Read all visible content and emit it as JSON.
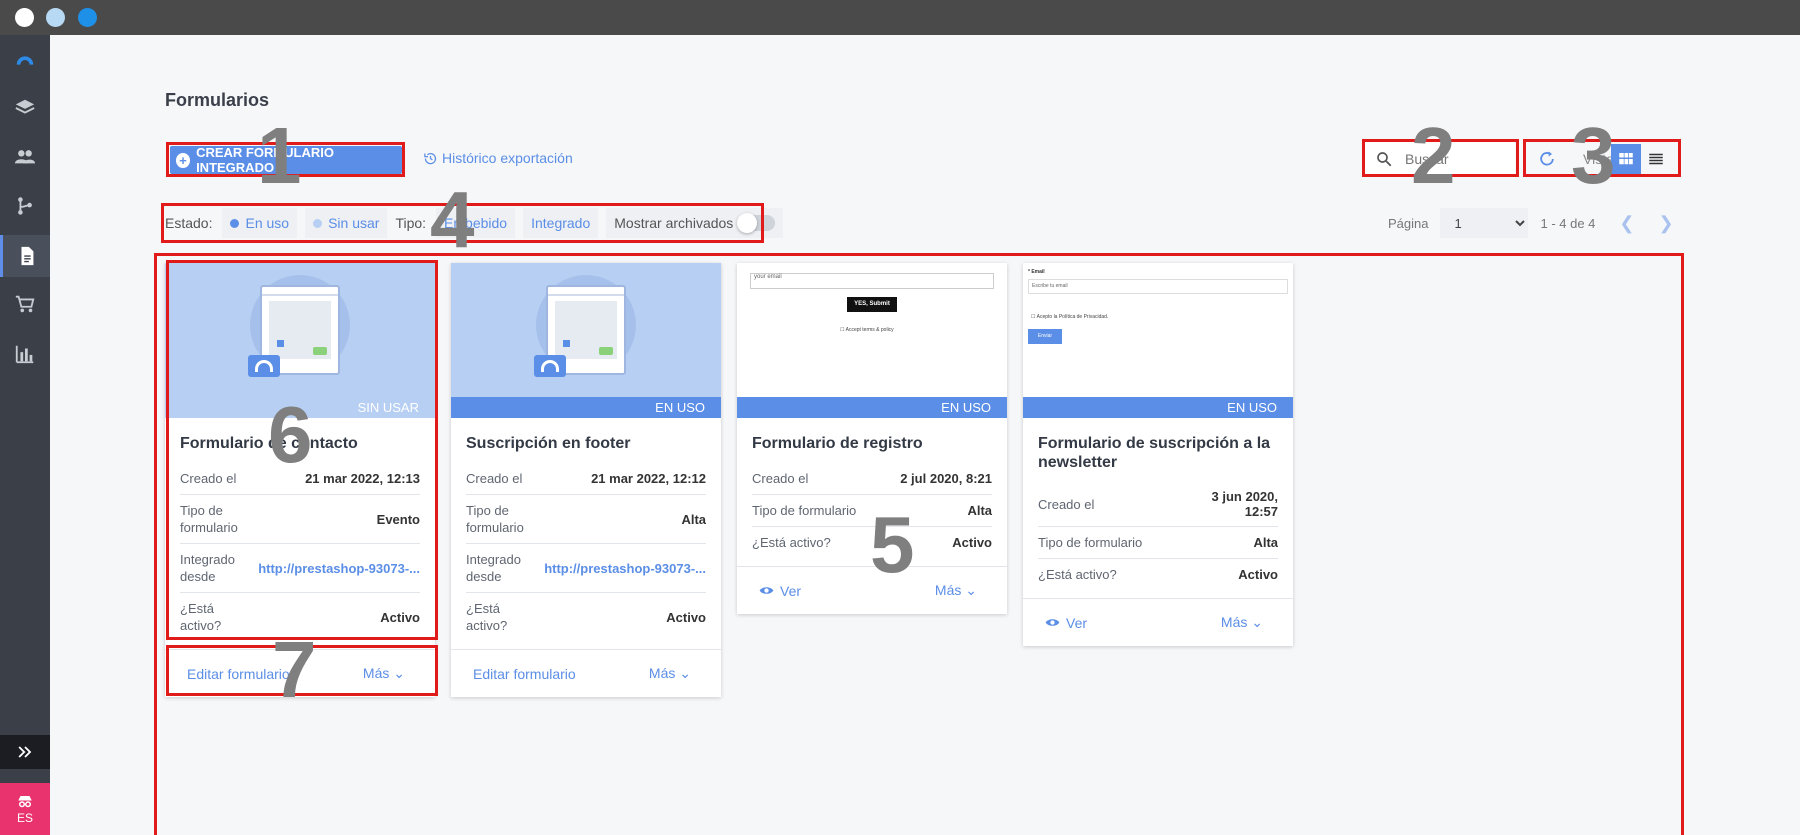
{
  "window": {
    "dots": [
      "close",
      "minimize",
      "zoom"
    ]
  },
  "sidebar": {
    "items": [
      "logo-icon",
      "layers-icon",
      "users-icon",
      "branch-icon",
      "document-icon",
      "cart-icon",
      "bar-chart-icon"
    ],
    "active": "document-icon",
    "expand_icon": "double-chevron-right-icon",
    "lang": "ES",
    "lang_icon": "incognito-icon"
  },
  "page": {
    "title": "Formularios"
  },
  "toolbar": {
    "create_label": "CREAR FORMULARIO INTEGRADO",
    "history_label": "Histórico exportación",
    "search_placeholder": "Buscar",
    "view_label": "Vista"
  },
  "filters": {
    "estado_label": "Estado:",
    "en_uso": "En uso",
    "sin_usar": "Sin usar",
    "tipo_label": "Tipo:",
    "embebido": "Embebido",
    "integrado": "Integrado",
    "archivados": "Mostrar archivados"
  },
  "pager": {
    "label": "Página",
    "page": "1",
    "count": "1 - 4 de 4"
  },
  "cards": [
    {
      "status": "SIN USAR",
      "title": "Formulario de contacto",
      "rows": [
        {
          "k": "Creado el",
          "v": "21 mar 2022, 12:13"
        },
        {
          "k": "Tipo de formulario",
          "v": "Evento"
        },
        {
          "k": "Integrado desde",
          "v": "http://prestashop-93073-..."
        },
        {
          "k": "¿Está activo?",
          "v": "Activo"
        }
      ],
      "action": "Editar formulario",
      "more": "Más"
    },
    {
      "status": "EN USO",
      "title": "Suscripción en footer",
      "rows": [
        {
          "k": "Creado el",
          "v": "21 mar 2022, 12:12"
        },
        {
          "k": "Tipo de formulario",
          "v": "Alta"
        },
        {
          "k": "Integrado desde",
          "v": "http://prestashop-93073-..."
        },
        {
          "k": "¿Está activo?",
          "v": "Activo"
        }
      ],
      "action": "Editar formulario",
      "more": "Más"
    },
    {
      "status": "EN USO",
      "title": "Formulario de registro",
      "preview": {
        "input": "your email",
        "button": "YES, Submit",
        "check": "Accept terms & policy"
      },
      "rows": [
        {
          "k": "Creado el",
          "v": "2 jul 2020, 8:21"
        },
        {
          "k": "Tipo de formulario",
          "v": "Alta"
        },
        {
          "k": "¿Está activo?",
          "v": "Activo"
        }
      ],
      "action": "Ver",
      "more": "Más"
    },
    {
      "status": "EN USO",
      "title": "Formulario de suscripción a la newsletter",
      "preview": {
        "label": "* Email",
        "input": "Escribe tu email",
        "check": "Acepto la Política de Privacidad.",
        "button": "Enviar"
      },
      "rows": [
        {
          "k": "Creado el",
          "v": "3 jun 2020, 12:57"
        },
        {
          "k": "Tipo de formulario",
          "v": "Alta"
        },
        {
          "k": "¿Está activo?",
          "v": "Activo"
        }
      ],
      "action": "Ver",
      "more": "Más"
    }
  ],
  "annotations": [
    "1",
    "2",
    "3",
    "4",
    "5",
    "6",
    "7"
  ],
  "colors": {
    "accent": "#5b8ee6",
    "sidebar": "#3a3f48",
    "highlight": "#e11a1a",
    "lang": "#e8336f"
  }
}
